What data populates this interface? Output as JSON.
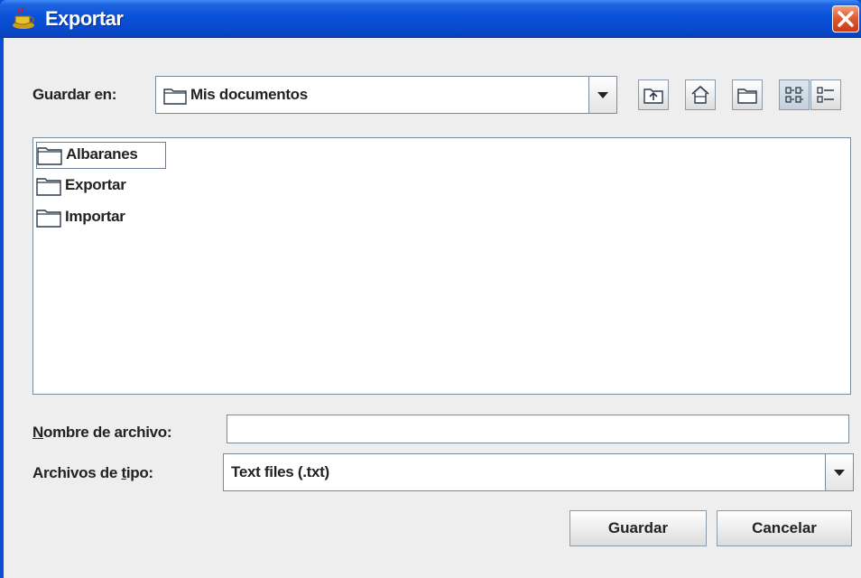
{
  "window": {
    "title": "Exportar"
  },
  "look_in": {
    "label": "Guardar en:",
    "value": "Mis documentos"
  },
  "toolbar": {
    "icons": [
      "up-folder-icon",
      "home-icon",
      "new-folder-icon",
      "list-view-icon",
      "details-view-icon"
    ]
  },
  "files": [
    {
      "name": "Albaranes"
    },
    {
      "name": "Exportar"
    },
    {
      "name": "Importar"
    }
  ],
  "filename": {
    "label_mnemonic": "N",
    "label_rest": "ombre de archivo:",
    "value": ""
  },
  "filetype": {
    "label_pre": "Archivos de ",
    "label_mnemonic": "t",
    "label_post": "ipo:",
    "value": "Text files (.txt)"
  },
  "buttons": {
    "save": "Guardar",
    "cancel": "Cancelar"
  },
  "colors": {
    "titlebar": "#0a50d8",
    "background": "#eeeeee",
    "close": "#e25a30"
  }
}
